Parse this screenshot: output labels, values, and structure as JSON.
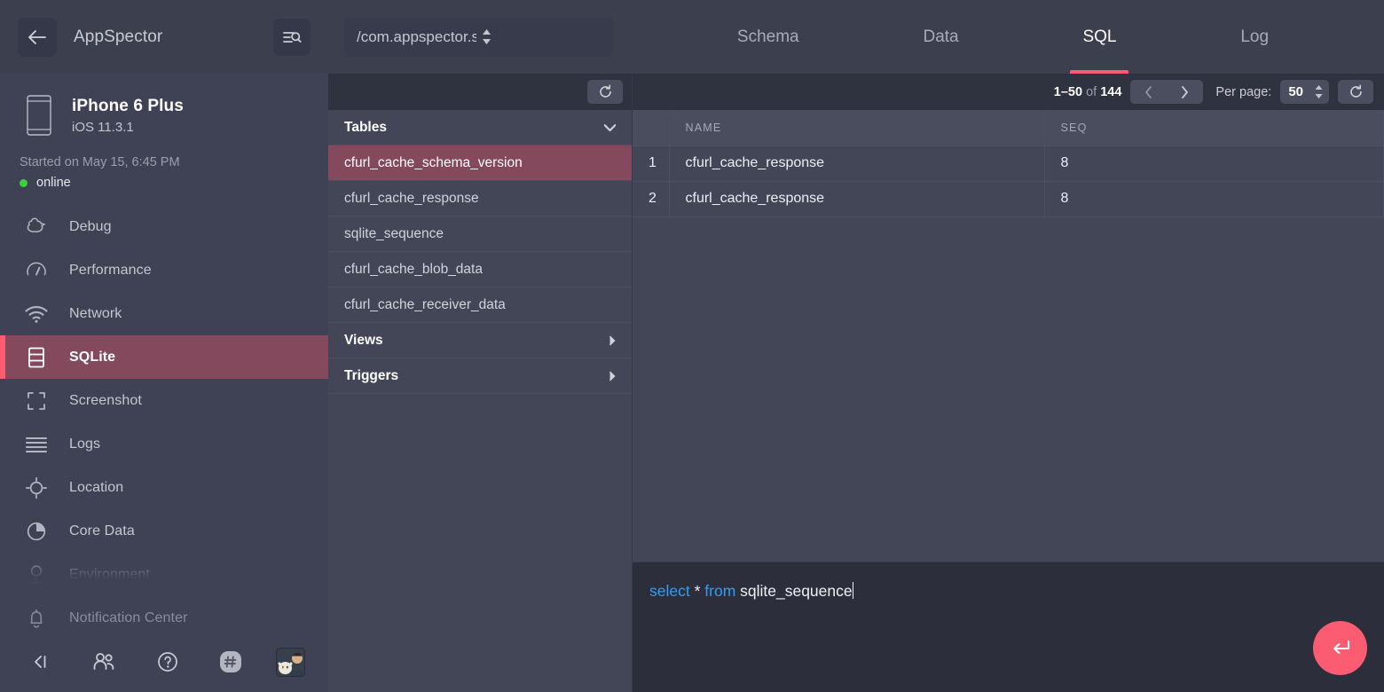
{
  "sidebar": {
    "back_icon": "arrow-left-icon",
    "app_title": "AppSpector",
    "filter_icon": "filter-search-icon",
    "device": {
      "icon": "phone-icon",
      "name": "iPhone 6 Plus",
      "os": "iOS 11.3.1",
      "started": "Started on May 15, 6:45 PM",
      "status": "online",
      "status_color": "#3bd13b"
    },
    "items": [
      {
        "label": "Debug",
        "icon": "duck-icon",
        "active": false
      },
      {
        "label": "Performance",
        "icon": "gauge-icon",
        "active": false
      },
      {
        "label": "Network",
        "icon": "wifi-icon",
        "active": false
      },
      {
        "label": "SQLite",
        "icon": "database-icon",
        "active": true
      },
      {
        "label": "Screenshot",
        "icon": "crop-frame-icon",
        "active": false
      },
      {
        "label": "Logs",
        "icon": "lines-icon",
        "active": false
      },
      {
        "label": "Location",
        "icon": "crosshair-icon",
        "active": false
      },
      {
        "label": "Core Data",
        "icon": "pie-chart-icon",
        "active": false
      },
      {
        "label": "Environment",
        "icon": "key-icon",
        "active": false
      },
      {
        "label": "Notification Center",
        "icon": "bell-icon",
        "active": false
      }
    ],
    "footer": [
      {
        "icon": "collapse-sidebar-icon"
      },
      {
        "icon": "team-icon"
      },
      {
        "icon": "help-circle-icon"
      },
      {
        "icon": "slack-icon"
      },
      {
        "icon": "user-avatar"
      }
    ],
    "accent_color": "#fc5c72",
    "active_bg": "#84495c"
  },
  "topbar": {
    "db_select_value": "/com.appspector.sample/...",
    "db_select_icon": "stepper-arrows-icon",
    "tabs": [
      {
        "label": "Schema",
        "active": false
      },
      {
        "label": "Data",
        "active": false
      },
      {
        "label": "SQL",
        "active": true
      },
      {
        "label": "Log",
        "active": false
      }
    ]
  },
  "tables_panel": {
    "refresh_icon": "refresh-icon",
    "groups": [
      {
        "label": "Tables",
        "chevron": "chevron-down-icon",
        "expanded": true,
        "items": [
          {
            "label": "cfurl_cache_schema_version",
            "selected": true
          },
          {
            "label": "cfurl_cache_response",
            "selected": false
          },
          {
            "label": "sqlite_sequence",
            "selected": false
          },
          {
            "label": "cfurl_cache_blob_data",
            "selected": false
          },
          {
            "label": "cfurl_cache_receiver_data",
            "selected": false
          }
        ]
      },
      {
        "label": "Views",
        "chevron": "chevron-right-icon",
        "expanded": false,
        "items": []
      },
      {
        "label": "Triggers",
        "chevron": "chevron-right-icon",
        "expanded": false,
        "items": []
      }
    ]
  },
  "data_panel": {
    "pager": {
      "range": "1–50",
      "of_label": "of",
      "total": "144",
      "prev_icon": "chevron-left-icon",
      "next_icon": "chevron-right-icon",
      "per_page_label": "Per page:",
      "per_page_value": "50",
      "per_page_stepper_icon": "stepper-arrows-icon",
      "refresh_icon": "refresh-icon"
    },
    "columns": [
      "NAME",
      "SEQ"
    ],
    "rows": [
      {
        "index": "1",
        "name": "cfurl_cache_response",
        "seq": "8"
      },
      {
        "index": "2",
        "name": "cfurl_cache_response",
        "seq": "8"
      }
    ]
  },
  "sql_editor": {
    "query_tokens": [
      {
        "text": "select",
        "type": "keyword"
      },
      {
        "text": " * ",
        "type": "plain"
      },
      {
        "text": "from",
        "type": "keyword"
      },
      {
        "text": " sqlite_sequence",
        "type": "plain"
      }
    ],
    "query_text": "select * from sqlite_sequence",
    "run_icon": "enter-return-icon",
    "run_color": "#fc5c72"
  }
}
